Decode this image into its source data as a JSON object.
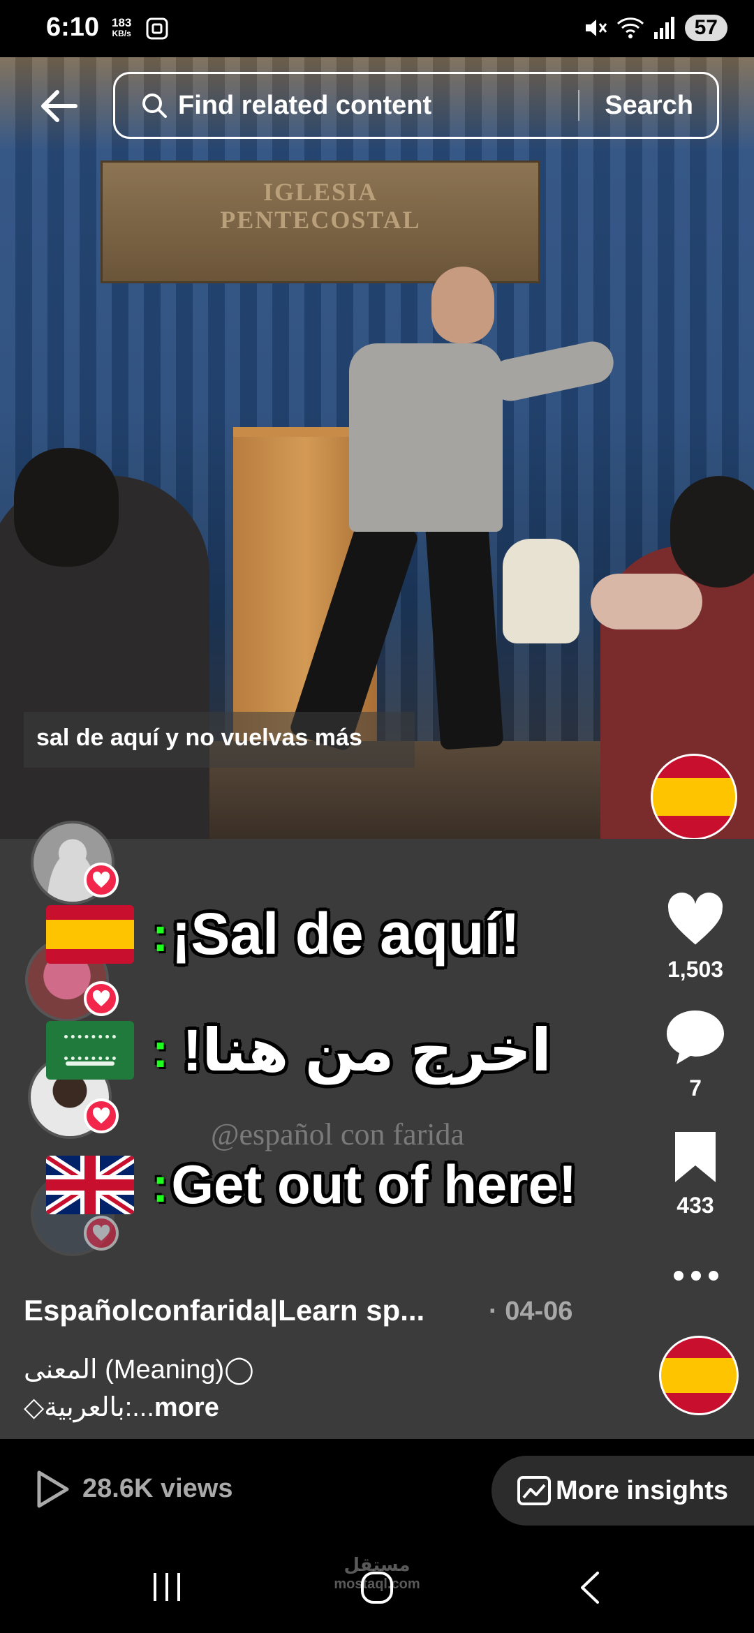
{
  "status_bar": {
    "time": "6:10",
    "speed_value": "183",
    "speed_unit": "KB/s",
    "battery": "57"
  },
  "search": {
    "placeholder": "Find related content",
    "button_label": "Search"
  },
  "video": {
    "sign_line1": "IGLESIA",
    "sign_line2": "PENTECOSTAL",
    "subtitle": "sal de aquí y no vuelvas más"
  },
  "phrases": [
    {
      "flag": "spain-flag",
      "text": "¡Sal de aquí!"
    },
    {
      "flag": "saudi-flag",
      "text": "اخرج من هنا!"
    },
    {
      "flag": "uk-flag",
      "text": "Get out of here!"
    }
  ],
  "watermark": "@español con farida",
  "actions": {
    "likes": "1,503",
    "comments": "7",
    "saves": "433"
  },
  "caption": {
    "title": "Españolconfarida|Learn sp...",
    "date": "· 04-06",
    "line1": "المعنى (Meaning)◯",
    "line2": "◇بالعربية:...",
    "more": "more"
  },
  "insights": {
    "views": "28.6K views",
    "more_insights": "More insights"
  },
  "nav": {
    "watermark_line1": "مستقل",
    "watermark_line2": "mostaql.com"
  },
  "colors": {
    "like": "#f2254a",
    "panel": "#3b3b3b",
    "colon_accent": "#1cff1c"
  }
}
